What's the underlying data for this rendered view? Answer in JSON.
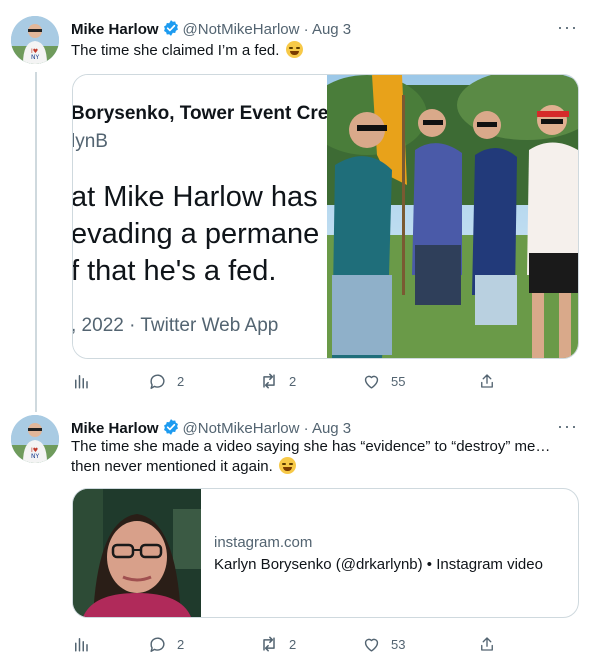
{
  "tweets": [
    {
      "author_name": "Mike Harlow",
      "handle_date": "@NotMikeHarlow · Aug 3",
      "more": "···",
      "text": "The time she claimed I’m a fed.",
      "media": {
        "quote_name": "Borysenko, Tower Event Crea",
        "quote_handle": "lynB",
        "quote_lines": [
          "at Mike Harlow has",
          " evading a permane",
          "f that he's a fed."
        ],
        "quote_date": ", 2022 · Twitter Web App"
      },
      "actions": {
        "replies": "2",
        "retweets": "2",
        "likes": "55"
      }
    },
    {
      "author_name": "Mike Harlow",
      "handle_date": "@NotMikeHarlow · Aug 3",
      "more": "···",
      "text_line1": "The time she made a video saying she has “evidence” to “destroy” me…",
      "text_line2": "then never mentioned it again.",
      "link": {
        "domain": "instagram.com",
        "title": "Karlyn Borysenko (@drkarlynb) • Instagram video"
      },
      "actions": {
        "replies": "2",
        "retweets": "2",
        "likes": "53"
      }
    }
  ],
  "icons": {
    "verified": "verified-badge-icon",
    "emoji": "tears-of-joy-emoji",
    "analytics": "bar-chart-icon",
    "reply": "speech-bubble-icon",
    "retweet": "retweet-arrows-icon",
    "like": "heart-icon",
    "share": "upload-arrow-icon"
  },
  "colors": {
    "accent": "#1d9bf0",
    "secondary_text": "#536471",
    "border": "#cfd9de"
  }
}
